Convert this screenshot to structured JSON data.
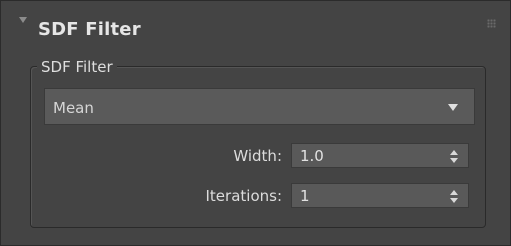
{
  "rollout": {
    "title": "SDF Filter",
    "collapse_icon": "triangle-down-icon",
    "grip_icon": "drag-grip-icon"
  },
  "group": {
    "title": "SDF Filter",
    "filter_type": {
      "selected": "Mean"
    },
    "width": {
      "label": "Width:",
      "value": "1.0"
    },
    "iterations": {
      "label": "Iterations:",
      "value": "1"
    }
  },
  "colors": {
    "panel_bg": "#444444",
    "field_bg": "#595959",
    "text": "#dcdcdc"
  }
}
